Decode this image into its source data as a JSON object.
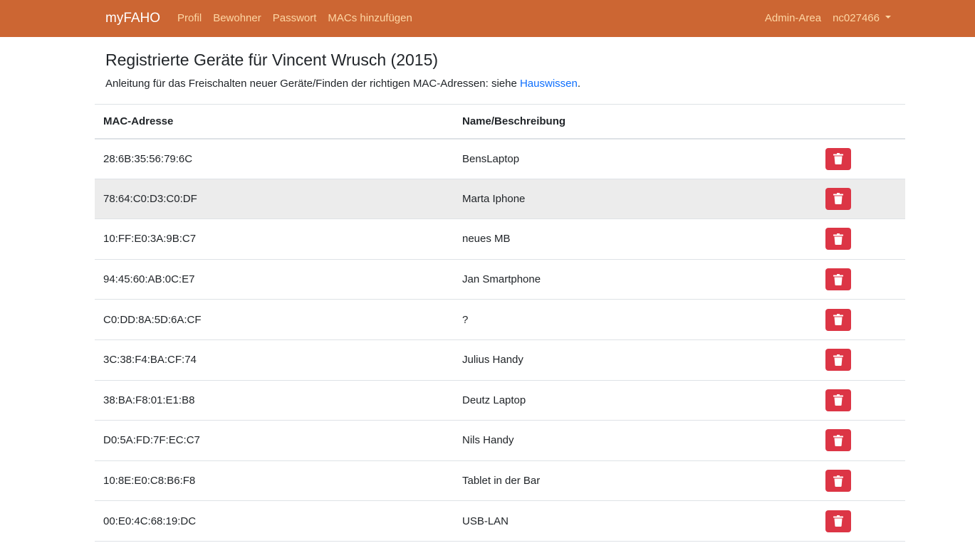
{
  "navbar": {
    "brand": "myFAHO",
    "links": [
      {
        "label": "Profil"
      },
      {
        "label": "Bewohner"
      },
      {
        "label": "Passwort"
      },
      {
        "label": "MACs hinzufügen"
      }
    ],
    "admin": "Admin-Area",
    "user": "nc027466",
    "background": "#cc6633"
  },
  "page": {
    "title": "Registrierte Geräte für Vincent Wrusch (2015)",
    "intro_text": "Anleitung für das Freischalten neuer Geräte/Finden der richtigen MAC-Adressen: siehe ",
    "intro_link": "Hauswissen",
    "intro_end": "."
  },
  "table": {
    "headers": {
      "mac": "MAC-Adresse",
      "name": "Name/Beschreibung"
    },
    "rows": [
      {
        "mac": "28:6B:35:56:79:6C",
        "name": "BensLaptop"
      },
      {
        "mac": "78:64:C0:D3:C0:DF",
        "name": "Marta Iphone"
      },
      {
        "mac": "10:FF:E0:3A:9B:C7",
        "name": "neues MB"
      },
      {
        "mac": "94:45:60:AB:0C:E7",
        "name": "Jan Smartphone"
      },
      {
        "mac": "C0:DD:8A:5D:6A:CF",
        "name": "?"
      },
      {
        "mac": "3C:38:F4:BA:CF:74",
        "name": "Julius Handy"
      },
      {
        "mac": "38:BA:F8:01:E1:B8",
        "name": "Deutz Laptop"
      },
      {
        "mac": "D0:5A:FD:7F:EC:C7",
        "name": "Nils Handy"
      },
      {
        "mac": "10:8E:E0:C8:B6:F8",
        "name": "Tablet in der Bar"
      },
      {
        "mac": "00:E0:4C:68:19:DC",
        "name": "USB-LAN"
      }
    ],
    "delete_icon": "trash-icon",
    "delete_color": "#dc3545"
  }
}
